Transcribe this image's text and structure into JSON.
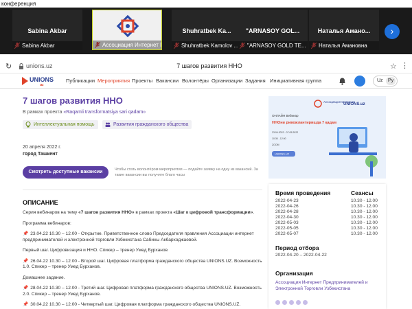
{
  "app": {
    "title": "конференция"
  },
  "participants": [
    {
      "tile_name": "Sabina Akbar",
      "footer": "Sabina Akbar"
    },
    {
      "tile_name": "",
      "footer": "Ассоциация Интернет П..."
    },
    {
      "tile_name": "Shuhratbek  Ka...",
      "footer": "Shuhratbek Kamolov ..."
    },
    {
      "tile_name": "\"ARNASOY GOL...",
      "footer": "\"ARNASOY GOLD TE..."
    },
    {
      "tile_name": "Наталья  Аманo...",
      "footer": "Наталья Амановна"
    }
  ],
  "browser": {
    "url": "unions.uz",
    "page_title": "7 шагов развития ННО",
    "reload_icon": "↻",
    "more_icon": "⋮",
    "bookmark_icon": "☆",
    "next_icon": "›"
  },
  "site": {
    "brand": "UNIONS",
    "brand_sub": "uz",
    "nav": [
      "Публикации",
      "Мероприятия",
      "Проекты",
      "Вакансии",
      "Волонтёры",
      "Организации",
      "Задания",
      "Инициативная группа"
    ],
    "active_nav": 1,
    "lang_uz": "Uz",
    "lang_ru": "Ру"
  },
  "event": {
    "title": "7 шагов развития ННО",
    "project_prefix": "В рамках проекта",
    "project_name": "«Raqamli transformatsiya sari qadam»",
    "tags": [
      "Интеллектуальная помощь",
      "Развития гражданского общества"
    ],
    "date": "20 апреля 2022 г.",
    "city": "город Ташкент",
    "cta_label": "Смотреть доступные вакансии",
    "cta_note": "Чтобы стать волонтёром мероприятия — подайте заявку на одну из вакансий. За такие вакансии вы получите благо часы"
  },
  "banner": {
    "org_left": "Ассоциация Интернет",
    "org_right": "UNIONS.uz",
    "label": "ОНЛАЙН Вебинар",
    "headline": "ННОни ривожлантиришда 7 қадам",
    "dates": "23.04.2022 - 07.05.2022",
    "time": "10:30 - 12:00",
    "platform": "ZOOM",
    "button": "UNIONS.UZ"
  },
  "description": {
    "heading": "ОПИСАНИЕ",
    "intro_1": "Серия вебинаров на тему ",
    "intro_bold_1": "«7 шагов развития ННО»",
    "intro_2": " в рамках проекта ",
    "intro_bold_2": "«Шаг к цифровой трансформации»",
    "intro_3": ".",
    "program": "Программа вебинаров:",
    "items": [
      "23.04.22  10.30 – 12.00 - Открытие. Приветственное слово Председателя правления Ассоциации интернет предпринимателей и электронной торговли Узбекистана Сабины Акбарходжаевой.",
      "Первый шаг. Цифровизация и ННО. Спикер – тренер Умед Бурханов",
      "26.04.22  10.30 – 12.00 - Второй шаг. Цифровая платформа гражданского общества UNIONS.UZ. Возможность 1.0.  Спикер – тренер Умед Бурханов.",
      "Домашнее задание.",
      "28.04.22  10.30 – 12.00 - Третий шаг. Цифровая платформа гражданского общества UNIONS.UZ. Возможность 2.0.  Спикер – тренер Умед Бурханов.",
      "30.04.22  10.30 – 12.00 - Четвертый шаг. Цифровая платформа гражданского общества UNIONS.UZ."
    ]
  },
  "info": {
    "time_heading": "Время проведения",
    "sessions_heading": "Сеансы",
    "dates": [
      "2022-04-23",
      "2022-04-26",
      "2022-04-28",
      "2022-04-30",
      "2022-05-03",
      "2022-05-05",
      "2022-05-07"
    ],
    "sessions": [
      "10.30 - 12.00",
      "10.30 - 12.00",
      "10.30 - 12.00",
      "10.30 - 12.00",
      "10.30 - 12.00",
      "10.30 - 12.00",
      "10.30 - 12.00"
    ],
    "selection_heading": "Период отбора",
    "selection_range": "2022-04-20 – 2022-04-22",
    "org_heading": "Организация",
    "org_name": "Ассоциация Интернет Предпринимателей и Электронной Торговли Узбекистана"
  }
}
